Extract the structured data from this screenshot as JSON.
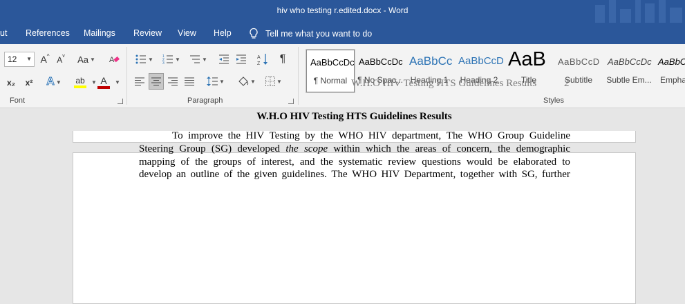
{
  "window": {
    "title": "hiv who testing r.edited.docx  -  Word"
  },
  "tabs": {
    "items": [
      "ut",
      "References",
      "Mailings",
      "Review",
      "View",
      "Help"
    ],
    "tell_me": "Tell me what you want to do"
  },
  "ribbon": {
    "font": {
      "size": "12",
      "group_label": "Font",
      "grow_label": "A",
      "shrink_label": "A",
      "case_label": "Aa",
      "subscript_label": "x₂",
      "superscript_label": "x²",
      "text_effects_label": "A",
      "highlight_label": "ab",
      "font_color_label": "A"
    },
    "paragraph": {
      "group_label": "Paragraph",
      "pilcrow": "¶"
    },
    "styles": {
      "group_label": "Styles",
      "items": [
        {
          "preview": "AaBbCcDc",
          "name": "¶ Normal",
          "selected": true
        },
        {
          "preview": "AaBbCcDc",
          "name": "¶ No Spac...",
          "selected": false
        },
        {
          "preview": "AaBbCc",
          "name": "Heading 1",
          "selected": false
        },
        {
          "preview": "AaBbCcD",
          "name": "Heading 2",
          "selected": false
        },
        {
          "preview": "AaB",
          "name": "Title",
          "selected": false
        },
        {
          "preview": "AaBbCcD",
          "name": "Subtitle",
          "selected": false
        },
        {
          "preview": "AaBbCcDc",
          "name": "Subtle Em...",
          "selected": false
        },
        {
          "preview": "AaBbCcDc",
          "name": "Empha",
          "selected": false
        }
      ]
    }
  },
  "document": {
    "header_text": "W.H.O HIV Testing HTS Guidelines Results",
    "page_number": "2",
    "title": "W.H.O HIV Testing HTS Guidelines Results",
    "lines": [
      [
        "To improve the HIV Testing by the WHO HIV department, The WHO Group Guideline"
      ],
      [
        "Steering Group (SG) developed ",
        "the scope",
        " within which the areas of concern, the demographic"
      ],
      [
        "mapping of the groups of interest, and the systematic review questions would be elaborated to"
      ],
      [
        "develop an outline of the given guidelines. The WHO HIV Department, together with SG, further"
      ]
    ]
  },
  "colors": {
    "brand": "#2b579a",
    "ribbon_bg": "#f3f3f3",
    "canvas": "#e6e6e6",
    "heading_blue": "#2e74b5",
    "font_color_bar": "#c00000",
    "highlight_bar": "#ffff00"
  }
}
